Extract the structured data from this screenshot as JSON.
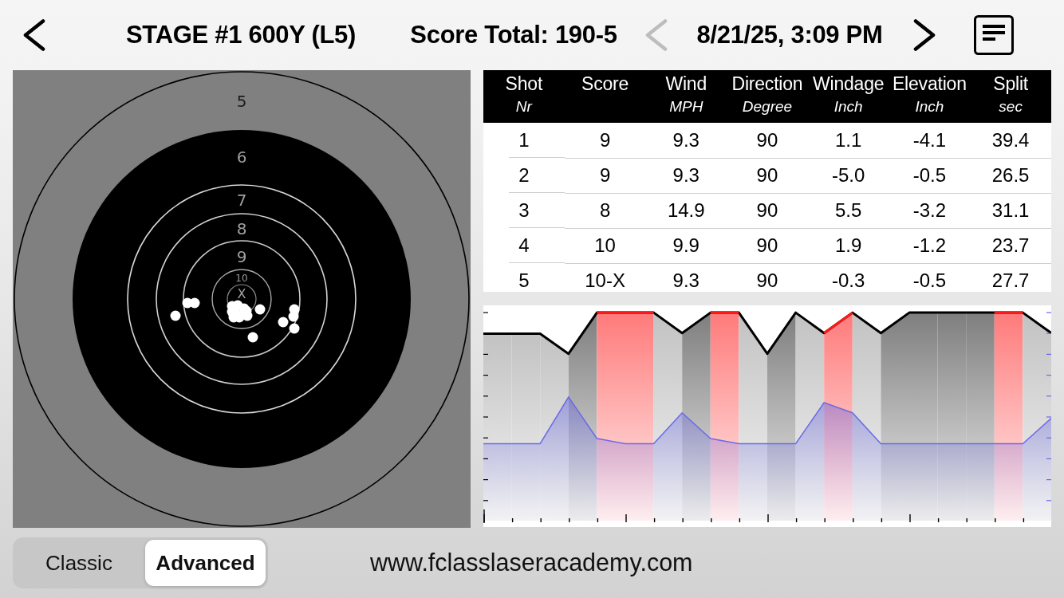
{
  "header": {
    "title": "STAGE #1 600Y (L5)",
    "score_total": "Score Total: 190-5",
    "previous": {
      "disabled": true
    },
    "date": "8/21/25, 3:09 PM",
    "next": {
      "disabled": false
    }
  },
  "target": {
    "ring_labels": [
      "5",
      "6",
      "7",
      "8",
      "9",
      "10",
      "X"
    ]
  },
  "table": {
    "columns": [
      {
        "title": "Shot",
        "unit": "Nr"
      },
      {
        "title": "Score"
      },
      {
        "title": "Wind",
        "unit": "MPH"
      },
      {
        "title": "Direction",
        "unit": "Degree"
      },
      {
        "title": "Windage",
        "unit": "Inch"
      },
      {
        "title": "Elevation",
        "unit": "Inch"
      },
      {
        "title": "Split",
        "unit": "sec"
      }
    ],
    "rows": [
      [
        "1",
        "9",
        "9.3",
        "90",
        "1.1",
        "-4.1",
        "39.4"
      ],
      [
        "2",
        "9",
        "9.3",
        "90",
        "-5.0",
        "-0.5",
        "26.5"
      ],
      [
        "3",
        "8",
        "14.9",
        "90",
        "5.5",
        "-3.2",
        "31.1"
      ],
      [
        "4",
        "10",
        "9.9",
        "90",
        "1.9",
        "-1.2",
        "23.7"
      ],
      [
        "5",
        "10-X",
        "9.3",
        "90",
        "-0.3",
        "-0.5",
        "27.7"
      ]
    ]
  },
  "segments": [
    {
      "label": "Classic",
      "selected": false
    },
    {
      "label": "Advanced",
      "selected": true
    }
  ],
  "footer": {
    "url": "www.fclasslaseracademy.com"
  }
}
